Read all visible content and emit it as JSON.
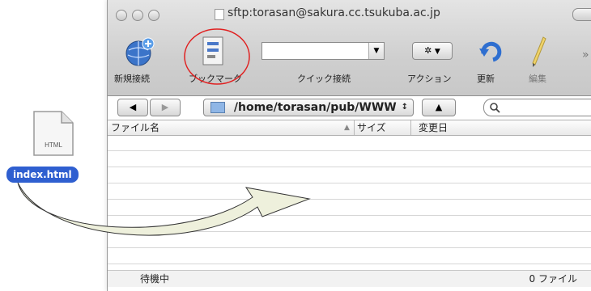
{
  "desktop": {
    "file_name": "index.html",
    "file_type_label": "HTML"
  },
  "window": {
    "title": "sftp:torasan@sakura.cc.tsukuba.ac.jp",
    "toolbar": {
      "new_connection": "新規接続",
      "bookmark": "ブックマーク",
      "quick_connect": "クイック接続",
      "action": "アクション",
      "refresh": "更新",
      "edit": "編集"
    },
    "quick_connect_value": "",
    "path": "/home/torasan/pub/WWW",
    "search_value": "",
    "columns": {
      "filename": "ファイル名",
      "size": "サイズ",
      "modified": "変更日"
    },
    "status": "待機中",
    "file_count": "0 ファイル"
  },
  "annotation": {
    "circle_color": "#e02020",
    "arrow_fill": "#eef0dc"
  }
}
